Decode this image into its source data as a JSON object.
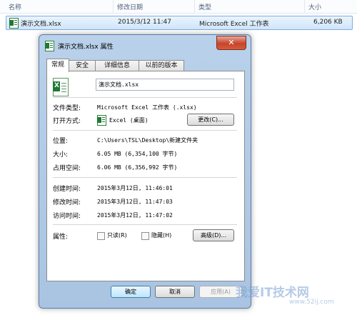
{
  "explorer": {
    "columns": [
      "名称",
      "修改日期",
      "类型",
      "大小"
    ],
    "file": {
      "name": "演示文档.xlsx",
      "modified": "2015/3/12 11:47",
      "type": "Microsoft Excel 工作表",
      "size": "6,206 KB"
    }
  },
  "dialog": {
    "title": "演示文档.xlsx 属性",
    "close_label": "✕",
    "tabs": [
      "常规",
      "安全",
      "详细信息",
      "以前的版本"
    ],
    "filename": "演示文档.xlsx",
    "rows": {
      "file_type": {
        "label": "文件类型:",
        "value": "Microsoft Excel 工作表 (.xlsx)"
      },
      "opens_with": {
        "label": "打开方式:",
        "value": "Excel (桌面)",
        "button": "更改(C)..."
      },
      "location": {
        "label": "位置:",
        "value": "C:\\Users\\TSL\\Desktop\\新建文件夹"
      },
      "size": {
        "label": "大小:",
        "value": "6.05 MB (6,354,100 字节)"
      },
      "size_on_disk": {
        "label": "占用空间:",
        "value": "6.06 MB (6,356,992 字节)"
      },
      "created": {
        "label": "创建时间:",
        "value": "2015年3月12日, 11:46:01"
      },
      "modified": {
        "label": "修改时间:",
        "value": "2015年3月12日, 11:47:03"
      },
      "accessed": {
        "label": "访问时间:",
        "value": "2015年3月12日, 11:47:02"
      }
    },
    "attributes": {
      "label": "属性:",
      "readonly": "只读(R)",
      "hidden": "隐藏(H)",
      "advanced": "高级(D)..."
    },
    "buttons": {
      "ok": "确定",
      "cancel": "取消",
      "apply": "应用(A)"
    }
  },
  "watermark": {
    "text": "我爱IT技术网",
    "url": "www.52ij.com"
  }
}
